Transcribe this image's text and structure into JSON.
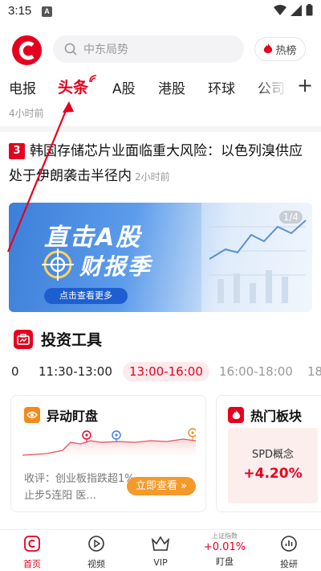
{
  "status": {
    "time": "3:15",
    "notif": "A"
  },
  "header": {
    "search_placeholder": "中东局势",
    "hot_label": "热榜"
  },
  "tabs": [
    "电报",
    "头条",
    "A股",
    "港股",
    "环球",
    "公司"
  ],
  "active_tab": "头条",
  "time_ago_top": "4小时前",
  "news": {
    "rank": "3",
    "title": "韩国存储芯片业面临重大风险：以色列溴供应处于伊朗袭击半径内",
    "time": "2小时前"
  },
  "banner": {
    "line1": "直击A股",
    "line2": "财报季",
    "button": "点击查看更多",
    "page": "1/4"
  },
  "tools": {
    "title": "投资工具",
    "slots": [
      "0",
      "11:30-13:00",
      "13:00-16:00",
      "16:00-18:00",
      "18"
    ]
  },
  "card1": {
    "title": "异动盯盘",
    "text": "收评：创业板指跌超1%止步5连阳 医...",
    "button": "立即查看 »"
  },
  "card2": {
    "title": "热门板块",
    "sector": "SPD概念",
    "value": "+4.20%"
  },
  "bottom_nav": {
    "home": "首页",
    "video": "视频",
    "vip": "VIP",
    "index_label": "上证指数",
    "index_value": "+0.01%",
    "watch": "盯盘",
    "research": "投研"
  },
  "colors": {
    "brand": "#e6001f",
    "orange": "#f39a2a"
  }
}
